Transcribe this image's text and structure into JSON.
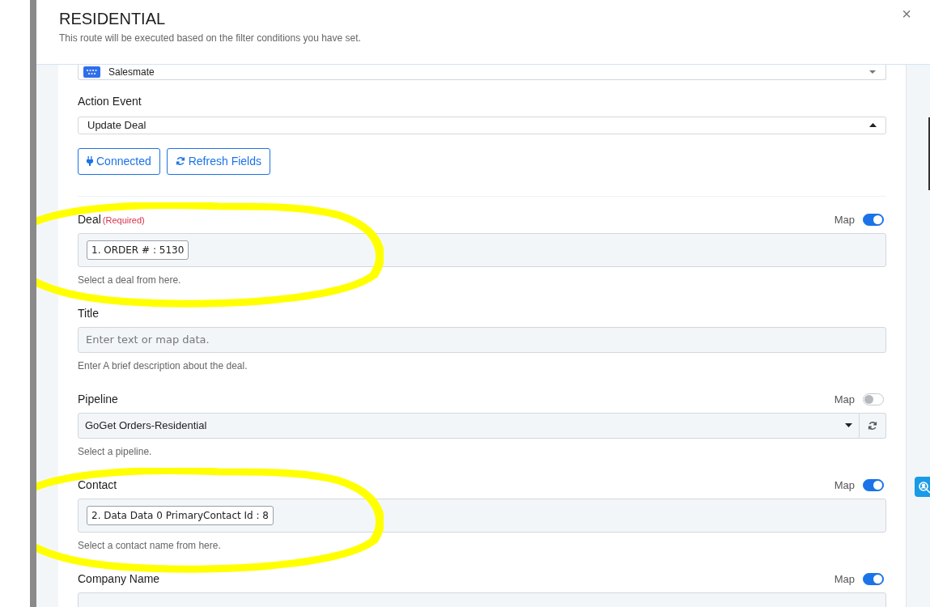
{
  "dialog": {
    "title": "RESIDENTIAL",
    "subtitle": "This route will be executed based on the filter conditions you have set.",
    "close": "×"
  },
  "app_select": {
    "value": "Salesmate"
  },
  "action_event": {
    "label": "Action Event",
    "value": "Update Deal",
    "expanded": true
  },
  "buttons": [
    {
      "label": "Connected",
      "kind": "plug"
    },
    {
      "label": "Refresh Fields",
      "kind": "refresh"
    }
  ],
  "fields": [
    {
      "kind": "mapped",
      "label": "Deal",
      "required": "(Required)",
      "map_label": "Map",
      "map_on": true,
      "token": "1. ORDER # : 5130",
      "help": "Select a deal from here.",
      "highlighted": true
    },
    {
      "kind": "text",
      "label": "Title",
      "placeholder": "Enter text or map data.",
      "help": "Enter A brief description about the deal.",
      "highlighted": false
    },
    {
      "kind": "select",
      "label": "Pipeline",
      "map_label": "Map",
      "map_on": false,
      "value": "GoGet Orders-Residential",
      "help": "Select a pipeline.",
      "highlighted": false
    },
    {
      "kind": "mapped",
      "label": "Contact",
      "map_label": "Map",
      "map_on": true,
      "token": "2. Data Data 0 PrimaryContact Id : 8",
      "help": "Select a contact name from here.",
      "highlighted": true
    },
    {
      "kind": "text",
      "label": "Company Name",
      "map_label": "Map",
      "map_on": true,
      "highlighted": false
    }
  ]
}
